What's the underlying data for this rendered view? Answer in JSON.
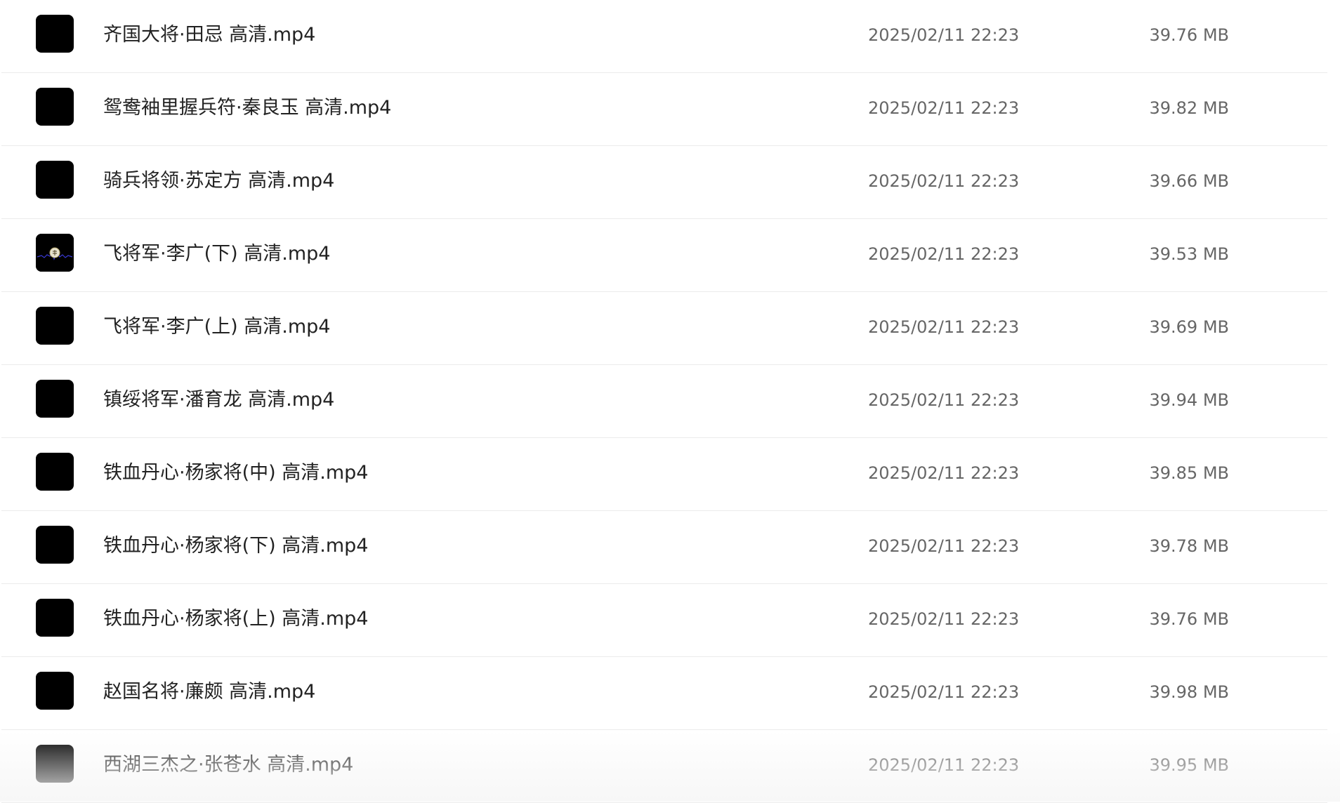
{
  "files": [
    {
      "name": "齐国大将·田忌 高清.mp4",
      "modified": "2025/02/11 22:23",
      "size": "39.76 MB",
      "thumbnail": "black"
    },
    {
      "name": "鸳鸯袖里握兵符·秦良玉 高清.mp4",
      "modified": "2025/02/11 22:23",
      "size": "39.82 MB",
      "thumbnail": "black"
    },
    {
      "name": "骑兵将领·苏定方 高清.mp4",
      "modified": "2025/02/11 22:23",
      "size": "39.66 MB",
      "thumbnail": "black"
    },
    {
      "name": "飞将军·李广(下) 高清.mp4",
      "modified": "2025/02/11 22:23",
      "size": "39.53 MB",
      "thumbnail": "logo-frame"
    },
    {
      "name": "飞将军·李广(上) 高清.mp4",
      "modified": "2025/02/11 22:23",
      "size": "39.69 MB",
      "thumbnail": "black"
    },
    {
      "name": "镇绥将军·潘育龙 高清.mp4",
      "modified": "2025/02/11 22:23",
      "size": "39.94 MB",
      "thumbnail": "black"
    },
    {
      "name": "铁血丹心·杨家将(中) 高清.mp4",
      "modified": "2025/02/11 22:23",
      "size": "39.85 MB",
      "thumbnail": "black"
    },
    {
      "name": "铁血丹心·杨家将(下) 高清.mp4",
      "modified": "2025/02/11 22:23",
      "size": "39.78 MB",
      "thumbnail": "black"
    },
    {
      "name": "铁血丹心·杨家将(上) 高清.mp4",
      "modified": "2025/02/11 22:23",
      "size": "39.76 MB",
      "thumbnail": "black"
    },
    {
      "name": "赵国名将·廉颇 高清.mp4",
      "modified": "2025/02/11 22:23",
      "size": "39.98 MB",
      "thumbnail": "black"
    },
    {
      "name": "西湖三杰之·张苍水 高清.mp4",
      "modified": "2025/02/11 22:23",
      "size": "39.95 MB",
      "thumbnail": "black"
    }
  ],
  "colors": {
    "background": "#ffffff",
    "filename_text": "#222222",
    "meta_text": "#666666",
    "divider": "#ebebeb",
    "thumbnail": "#000000"
  }
}
